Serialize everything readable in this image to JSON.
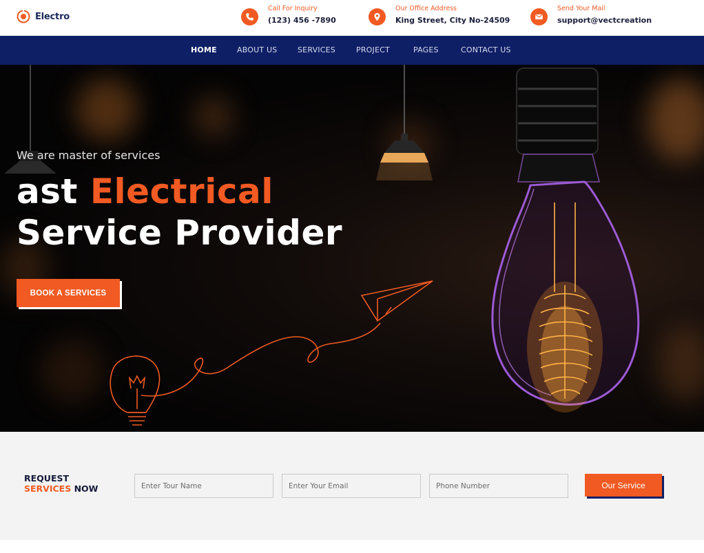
{
  "brand": {
    "name": "Electro"
  },
  "contacts": [
    {
      "label": "Call For Inquiry",
      "value": "(123) 456 -7890",
      "icon": "phone-icon"
    },
    {
      "label": "Our Office Address",
      "value": "King Street, City No-24509",
      "icon": "location-pin-icon"
    },
    {
      "label": "Send Your Mail",
      "value": "support@vectcreation",
      "icon": "mail-icon"
    }
  ],
  "nav": {
    "items": [
      {
        "label": "HOME",
        "active": true
      },
      {
        "label": "ABOUT US",
        "active": false
      },
      {
        "label": "SERVICES",
        "active": false
      },
      {
        "label": "PROJECT",
        "active": false
      },
      {
        "label": "PAGES",
        "active": false
      },
      {
        "label": "CONTACT US",
        "active": false
      }
    ]
  },
  "hero": {
    "subtitle": "We are master of services",
    "title_line1_plain": "ast ",
    "title_line1_accent": "Electrical",
    "title_line2": "Service Provider",
    "cta_label": "BOOK A SERVICES"
  },
  "request": {
    "title_line1": "REQUEST",
    "title_accent": "SERVICES",
    "title_rest": " NOW",
    "name_placeholder": "Enter Tour Name",
    "email_placeholder": "Enter Your Email",
    "phone_placeholder": "Phone Number",
    "submit_label": "Our Service"
  },
  "colors": {
    "accent": "#f15a22",
    "navy": "#0f1f66",
    "dark_text": "#1b1f3b",
    "section_bg": "#f3f3f3"
  }
}
